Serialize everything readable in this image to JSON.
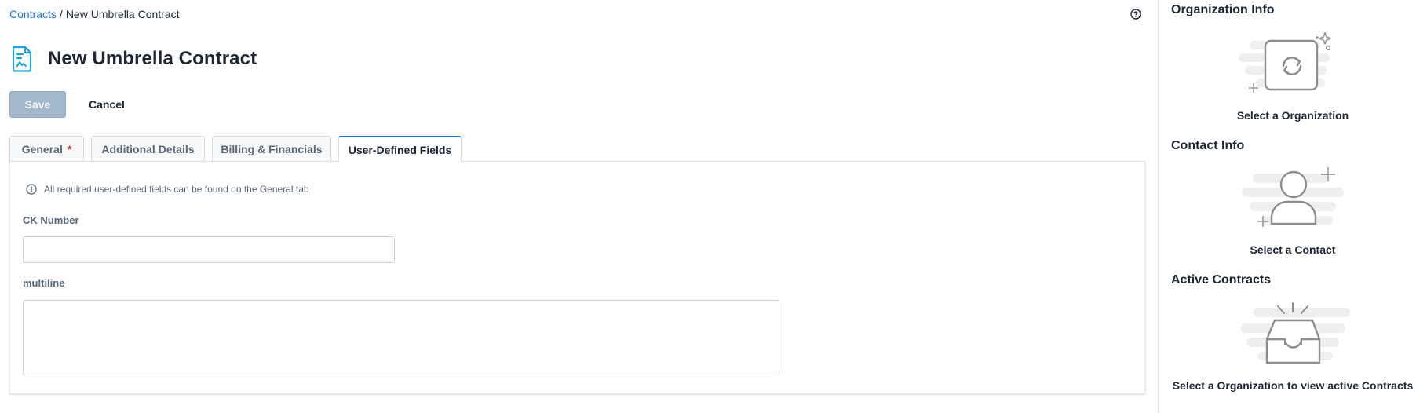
{
  "breadcrumb": {
    "parent": "Contracts",
    "separator": "/",
    "current": "New Umbrella Contract"
  },
  "page": {
    "title": "New Umbrella Contract"
  },
  "toolbar": {
    "save_label": "Save",
    "cancel_label": "Cancel"
  },
  "tabs": [
    {
      "label": "General",
      "required_marker": "*"
    },
    {
      "label": "Additional Details"
    },
    {
      "label": "Billing & Financials"
    },
    {
      "label": "User-Defined Fields",
      "active": true
    }
  ],
  "form": {
    "info_note": "All required user-defined fields can be found on the General tab",
    "fields": [
      {
        "label": "CK Number",
        "value": ""
      },
      {
        "label": "multiline",
        "value": ""
      }
    ]
  },
  "sidebar": {
    "organization": {
      "title": "Organization Info",
      "caption": "Select a Organization"
    },
    "contact": {
      "title": "Contact Info",
      "caption": "Select a Contact"
    },
    "contracts": {
      "title": "Active Contracts",
      "caption": "Select a Organization to view active Contracts"
    }
  },
  "colors": {
    "accent": "#1976d2",
    "required": "#d32f2f",
    "disabled_button": "#a4b9cc"
  },
  "icons": [
    "help-icon",
    "contract-document-icon",
    "info-icon",
    "organization-sync-icon",
    "contact-person-icon",
    "inbox-tray-icon"
  ]
}
